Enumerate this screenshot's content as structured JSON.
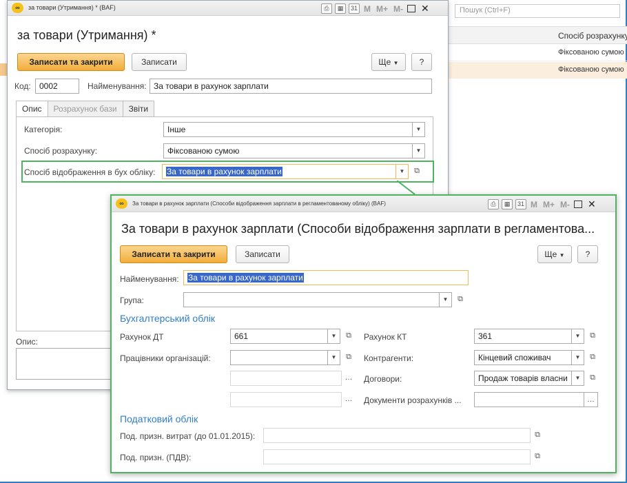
{
  "background": {
    "search_placeholder": "Пошук (Ctrl+F)",
    "column_header": "Спосіб розрахунку",
    "rows": [
      "Фіксованою сумою",
      "Фіксованою сумою"
    ]
  },
  "window1": {
    "title": "за товари (Утримання) * (BAF)",
    "form_title": "за товари (Утримання) *",
    "save_close": "Записати та закрити",
    "save": "Записати",
    "more": "Ще",
    "help": "?",
    "code_label": "Код:",
    "code_value": "0002",
    "name_label": "Найменування:",
    "name_value": "За товари в рахунок зарплати",
    "tabs": [
      "Опис",
      "Розрахунок бази",
      "Звіти"
    ],
    "category_label": "Категорія:",
    "category_value": "Інше",
    "calc_label": "Спосіб розрахунку:",
    "calc_value": "Фіксованою сумою",
    "display_label": "Спосіб відображення в бух обліку:",
    "display_value": "За товари в рахунок зарплати",
    "description_label": "Опис:"
  },
  "window2": {
    "title": "За товари в рахунок зарплати (Способи відображення зарплати в регламентованому обліку) (BAF)",
    "form_title": "За товари в рахунок зарплати (Способи відображення зарплати в регламентова...",
    "save_close": "Записати та закрити",
    "save": "Записати",
    "more": "Ще",
    "help": "?",
    "name_label": "Найменування:",
    "name_value": "За товари в рахунок зарплати",
    "group_label": "Група:",
    "group_value": "",
    "accounting_head": "Бухгалтерський облік",
    "debit_label": "Рахунок ДТ",
    "debit_value": "661",
    "credit_label": "Рахунок КТ",
    "credit_value": "361",
    "employees_label": "Працівники організацій:",
    "employees_value": "",
    "contractors_label": "Контрагенти:",
    "contractors_value": "Кінцевий споживач",
    "contracts_label": "Договори:",
    "contracts_value": "Продаж товарів власни",
    "settlement_docs_label": "Документи розрахунків ...",
    "tax_head": "Податковий облік",
    "tax_expense_label": "Под. призн. витрат (до 01.01.2015):",
    "tax_vat_label": "Под. призн. (ПДВ):"
  },
  "toolbar_icons": {
    "memory": [
      "M",
      "M+",
      "M-"
    ],
    "calendar_day": "31"
  },
  "colors": {
    "accent_blue": "#2f7ec8",
    "primary_button": "#f2ad3b",
    "highlight_green": "#4db35f",
    "selection": "#3967c8"
  }
}
